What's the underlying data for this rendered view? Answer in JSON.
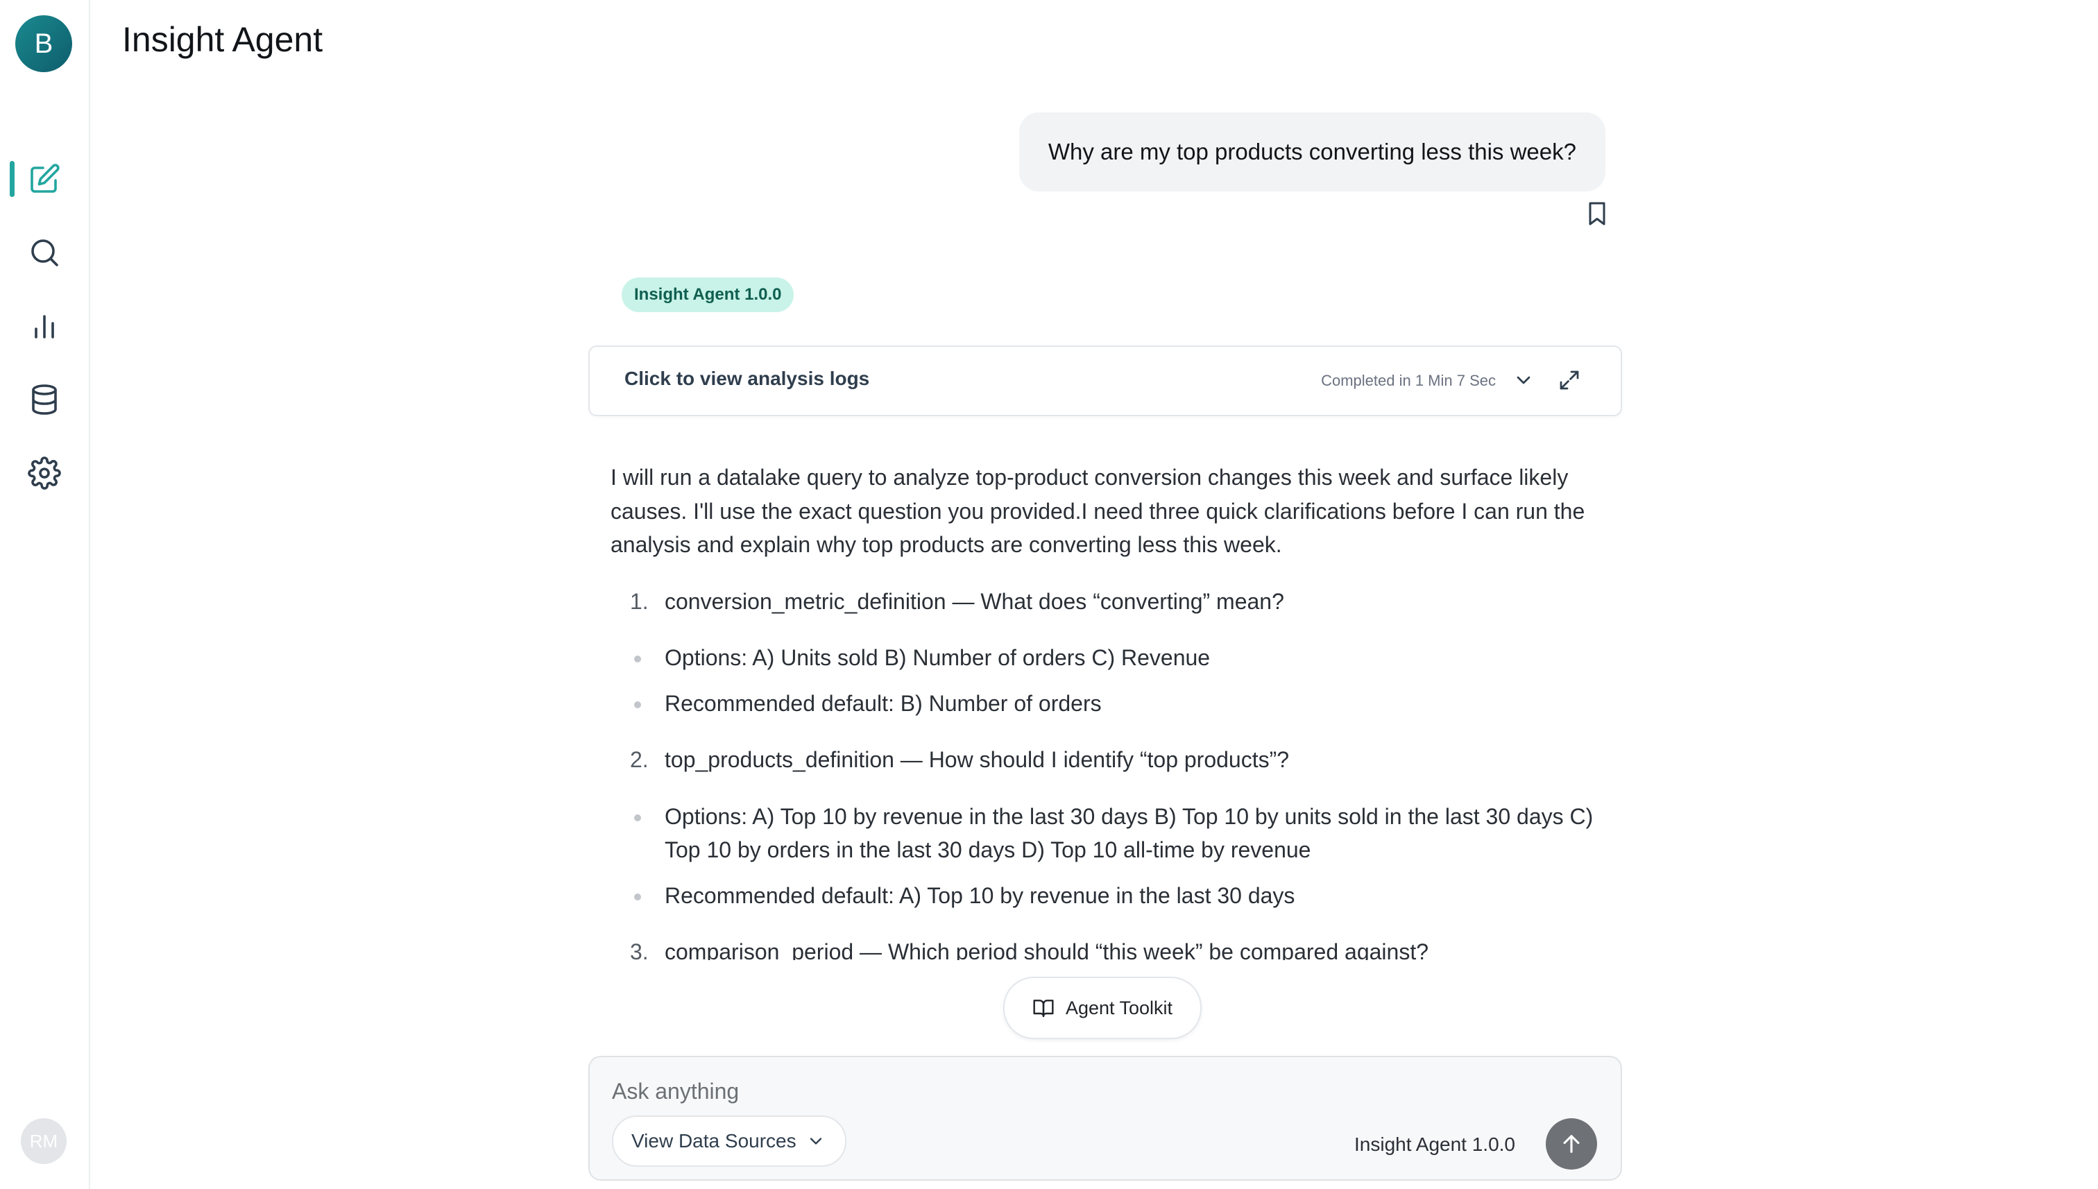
{
  "brand": {
    "logo_letter": "B",
    "accent_color": "#22a69f"
  },
  "app_title": "Insight Agent",
  "sidebar": {
    "items": [
      {
        "icon": "new-chat-icon",
        "active": true
      },
      {
        "icon": "search-icon",
        "active": false
      },
      {
        "icon": "analytics-icon",
        "active": false
      },
      {
        "icon": "database-icon",
        "active": false
      },
      {
        "icon": "settings-icon",
        "active": false
      }
    ],
    "user_initials": "RM"
  },
  "conversation": {
    "user_message": "Why are my top products converting less this week?",
    "agent_badge": "Insight Agent 1.0.0",
    "logs": {
      "label": "Click to view analysis logs",
      "status": "Completed in 1 Min 7 Sec"
    },
    "intro": "I will run a datalake query to analyze top-product conversion changes this week and surface likely causes. I'll use the exact question you provided.I need three quick clarifications before I can run the analysis and explain why top products are converting less this week.",
    "questions": [
      {
        "number": "1.",
        "title": "conversion_metric_definition — What does “converting” mean?",
        "bullets": [
          "Options: A) Units sold B) Number of orders C) Revenue",
          "Recommended default: B) Number of orders"
        ]
      },
      {
        "number": "2.",
        "title": "top_products_definition — How should I identify “top products”?",
        "bullets": [
          "Options: A) Top 10 by revenue in the last 30 days B) Top 10 by units sold in the last 30 days C) Top 10 by orders in the last 30 days D) Top 10 all-time by revenue",
          "Recommended default: A) Top 10 by revenue in the last 30 days"
        ]
      },
      {
        "number": "3.",
        "title": "comparison_period — Which period should “this week” be compared against?",
        "bullets": []
      }
    ]
  },
  "toolkit": {
    "label": "Agent Toolkit"
  },
  "composer": {
    "placeholder": "Ask anything",
    "value": "",
    "data_sources_label": "View Data Sources",
    "model_label": "Insight Agent 1.0.0"
  }
}
